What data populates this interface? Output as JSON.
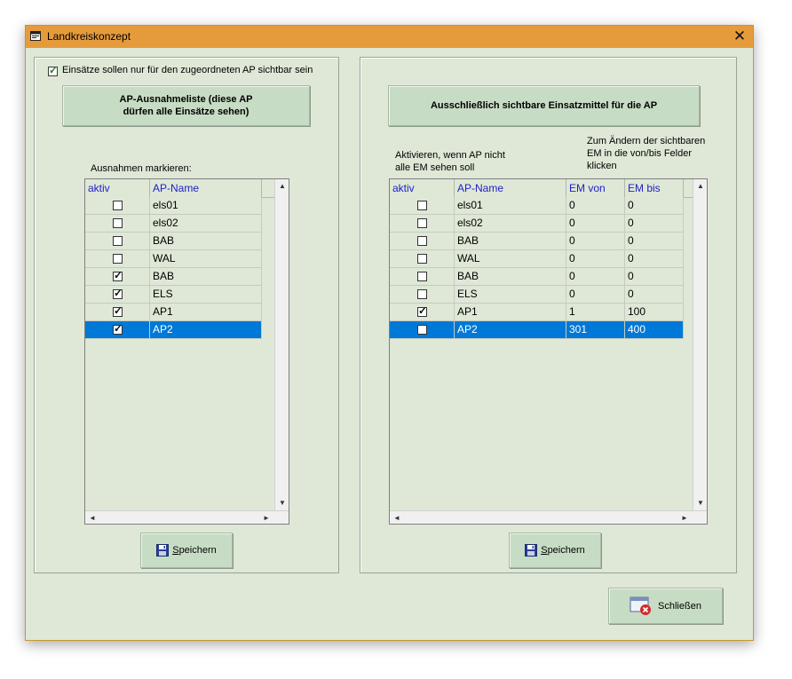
{
  "window": {
    "title": "Landkreiskonzept",
    "close_glyph": "✕"
  },
  "left": {
    "checkbox": {
      "label": "Einsätze sollen nur für den zugeordneten AP sichtbar sein",
      "checked": true
    },
    "heading_line1": "AP-Ausnahmeliste (diese AP",
    "heading_line2": "dürfen alle Einsätze sehen)",
    "grid_caption": "Ausnahmen markieren:",
    "columns": [
      "aktiv",
      "AP-Name"
    ],
    "rows": [
      {
        "checked": false,
        "name": "els01"
      },
      {
        "checked": false,
        "name": "els02"
      },
      {
        "checked": false,
        "name": "BAB"
      },
      {
        "checked": false,
        "name": "WAL"
      },
      {
        "checked": true,
        "name": "BAB"
      },
      {
        "checked": true,
        "name": "ELS"
      },
      {
        "checked": true,
        "name": "AP1"
      },
      {
        "checked": true,
        "name": "AP2",
        "selected": true
      }
    ],
    "save_prefix": "",
    "save_mnemonic": "S",
    "save_rest": "peichern"
  },
  "right": {
    "heading": "Ausschließlich sichtbare Einsatzmittel für die AP",
    "hint_left_line1": "Aktivieren, wenn AP nicht",
    "hint_left_line2": "alle EM sehen soll",
    "hint_right_line1": "Zum Ändern der sichtbaren",
    "hint_right_line2": "EM in die von/bis Felder",
    "hint_right_line3": "klicken",
    "columns": [
      "aktiv",
      "AP-Name",
      "EM von",
      "EM bis"
    ],
    "rows": [
      {
        "checked": false,
        "name": "els01",
        "von": "0",
        "bis": "0"
      },
      {
        "checked": false,
        "name": "els02",
        "von": "0",
        "bis": "0"
      },
      {
        "checked": false,
        "name": "BAB",
        "von": "0",
        "bis": "0"
      },
      {
        "checked": false,
        "name": "WAL",
        "von": "0",
        "bis": "0"
      },
      {
        "checked": false,
        "name": "BAB",
        "von": "0",
        "bis": "0"
      },
      {
        "checked": false,
        "name": "ELS",
        "von": "0",
        "bis": "0"
      },
      {
        "checked": true,
        "name": "AP1",
        "von": "1",
        "bis": "100"
      },
      {
        "checked": false,
        "name": "AP2",
        "von": "301",
        "bis": "400",
        "selected": true
      }
    ],
    "save_mnemonic": "S",
    "save_rest": "peichern"
  },
  "close_button": {
    "label": "Schließen"
  },
  "scroll": {
    "up": "▲",
    "down": "▼",
    "left": "◄",
    "right": "►"
  },
  "check_glyph": "✓",
  "colors": {
    "title_bar": "#e59b3c",
    "window_bg": "#dfe8d7",
    "selection": "#0078d7",
    "header_text": "#2020c8"
  }
}
